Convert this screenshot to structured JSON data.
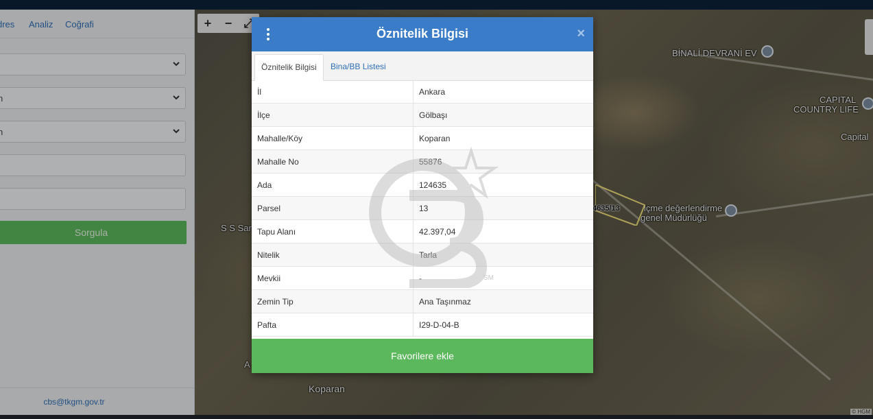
{
  "sidebar": {
    "tabs": [
      "dres",
      "Analiz",
      "Coğrafi"
    ],
    "fields": [
      {
        "value": "",
        "type": "select"
      },
      {
        "value": "n",
        "type": "select"
      },
      {
        "value": "n",
        "type": "select"
      },
      {
        "value": "",
        "type": "text"
      },
      {
        "value": "",
        "type": "text"
      }
    ],
    "query_button": "Sorgula",
    "email": "cbs@tkgm.gov.tr"
  },
  "map": {
    "controls": [
      "+",
      "−",
      "⤢"
    ],
    "labels": {
      "poi1": "BİNALİ DEVRANİ EV",
      "poi2a": "CAPITAL",
      "poi2b": "COUNTRY LIFE",
      "poi3": "Capital",
      "poi4a": "lçme değerlendirme",
      "poi4b": "genel Müdürlüğü",
      "parcel": "4635/13",
      "place1": "S S Sar",
      "place2": "Koparan",
      "place3": "A"
    },
    "copyright": "© HGM"
  },
  "modal": {
    "title": "Öznitelik Bilgisi",
    "close": "×",
    "tabs": {
      "active": "Öznitelik Bilgisi",
      "other": "Bina/BB Listesi"
    },
    "rows": [
      {
        "key": "İl",
        "value": "Ankara"
      },
      {
        "key": "İlçe",
        "value": "Gölbaşı"
      },
      {
        "key": "Mahalle/Köy",
        "value": "Koparan"
      },
      {
        "key": "Mahalle No",
        "value": "55876"
      },
      {
        "key": "Ada",
        "value": "124635"
      },
      {
        "key": "Parsel",
        "value": "13"
      },
      {
        "key": "Tapu Alanı",
        "value": "42.397,04"
      },
      {
        "key": "Nitelik",
        "value": "Tarla"
      },
      {
        "key": "Mevkii",
        "value": "-"
      },
      {
        "key": "Zemin Tip",
        "value": "Ana Taşınmaz"
      },
      {
        "key": "Pafta",
        "value": "I29-D-04-B"
      }
    ],
    "favorite_button": "Favorilere ekle",
    "watermark_text": "SM"
  },
  "colors": {
    "accent": "#3a7cc8",
    "success": "#5cb85c",
    "link": "#2f6eb5"
  }
}
